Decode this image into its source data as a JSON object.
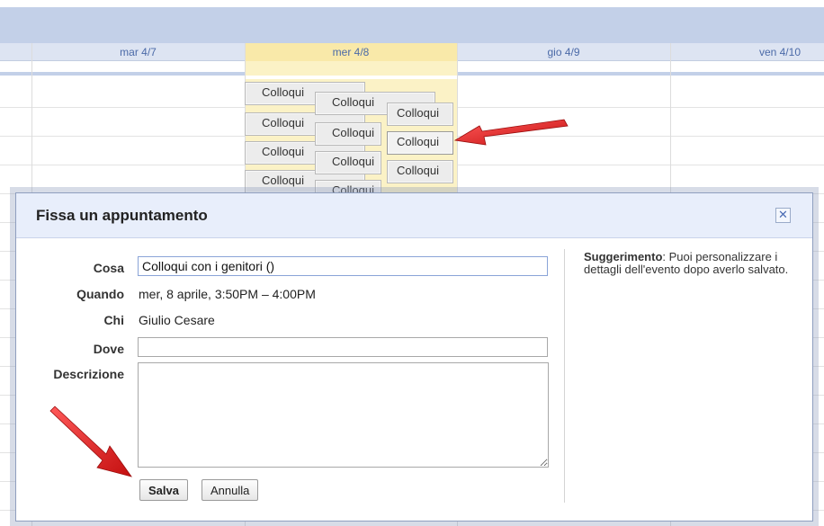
{
  "calendar": {
    "days": [
      {
        "label": "mar 4/7",
        "today": false
      },
      {
        "label": "mer 4/8",
        "today": true
      },
      {
        "label": "gio 4/9",
        "today": false
      },
      {
        "label": "ven 4/10",
        "today": false
      }
    ],
    "event_label": "Colloqui",
    "event_label_cut": "Colloqui"
  },
  "dialog": {
    "title": "Fissa un appuntamento",
    "close_icon": "close-icon",
    "fields": {
      "cosa_label": "Cosa",
      "cosa_value": "Colloqui con i genitori ()",
      "quando_label": "Quando",
      "quando_value": "mer, 8 aprile, 3:50PM – 4:00PM",
      "chi_label": "Chi",
      "chi_value": "Giulio Cesare",
      "dove_label": "Dove",
      "dove_value": "",
      "descrizione_label": "Descrizione",
      "descrizione_value": ""
    },
    "buttons": {
      "save": "Salva",
      "cancel": "Annulla"
    },
    "hint": {
      "bold": "Suggerimento",
      "text": ": Puoi personalizzare i dettagli dell'evento dopo averlo salvato."
    }
  },
  "colors": {
    "header_band": "#c3d0e8",
    "today": "#f9e9a9",
    "arrow": "#e11d1d",
    "dialog_header": "#e8eefb"
  }
}
